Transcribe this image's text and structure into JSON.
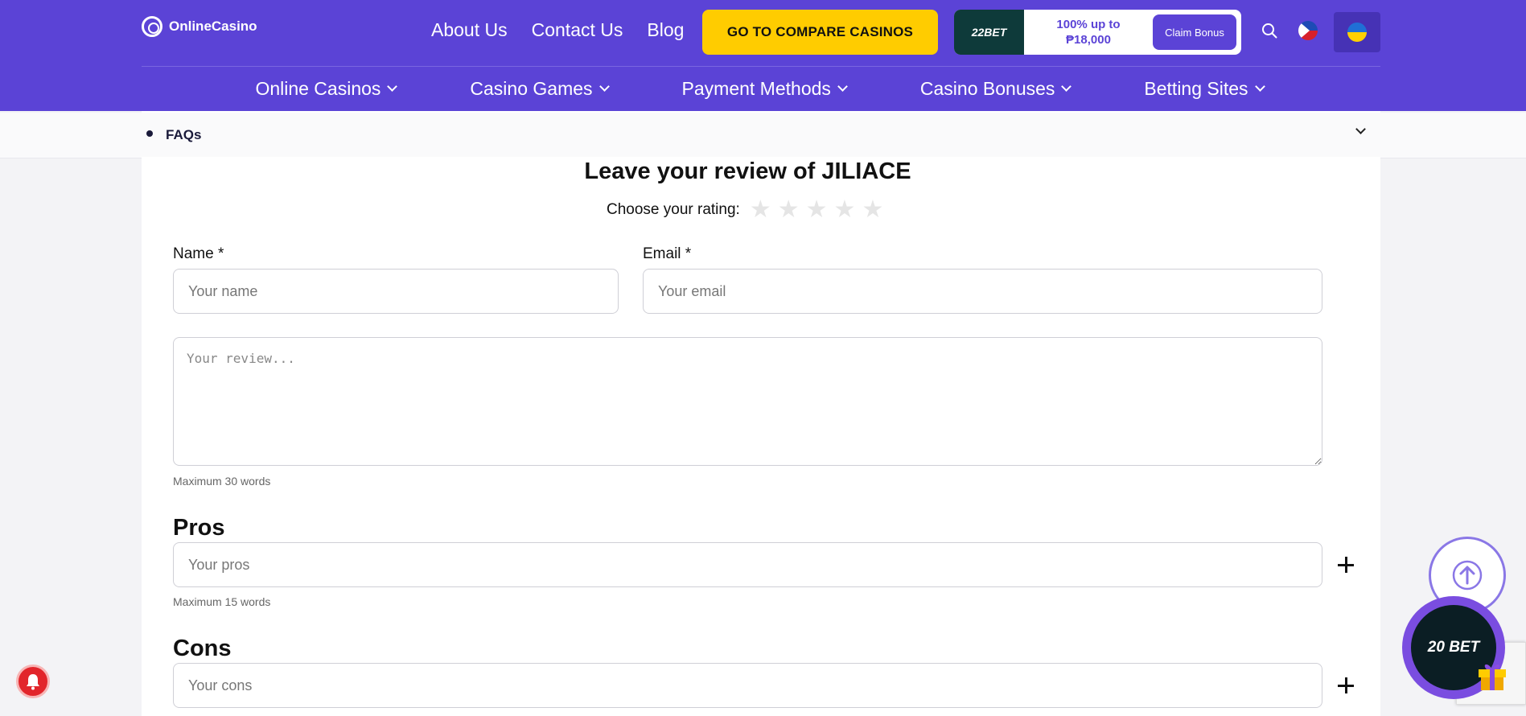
{
  "header": {
    "logo_text": "OnlineCasino",
    "top_links": [
      "About Us",
      "Contact Us",
      "Blog"
    ],
    "compare_button": "GO TO COMPARE CASINOS",
    "promo": {
      "brand": "22BET",
      "offer_line1": "100% up to",
      "offer_line2": "₱18,000",
      "claim": "Claim Bonus"
    },
    "main_nav": [
      "Online Casinos",
      "Casino Games",
      "Payment Methods",
      "Casino Bonuses",
      "Betting Sites"
    ],
    "colors": {
      "header_bg": "#5b43d6",
      "cta": "#ffcc00"
    }
  },
  "faq": {
    "label": "FAQs"
  },
  "review_form": {
    "title": "Leave your review of JILIACE",
    "rating_label": "Choose your rating:",
    "stars": 5,
    "name_label": "Name *",
    "name_placeholder": "Your name",
    "email_label": "Email *",
    "email_placeholder": "Your email",
    "review_placeholder": "Your review...",
    "review_hint": "Maximum 30 words",
    "pros_heading": "Pros",
    "pros_placeholder": "Your pros",
    "pros_hint": "Maximum 15 words",
    "cons_heading": "Cons",
    "cons_placeholder": "Your cons"
  },
  "floating": {
    "bet_badge": "20 BET"
  }
}
